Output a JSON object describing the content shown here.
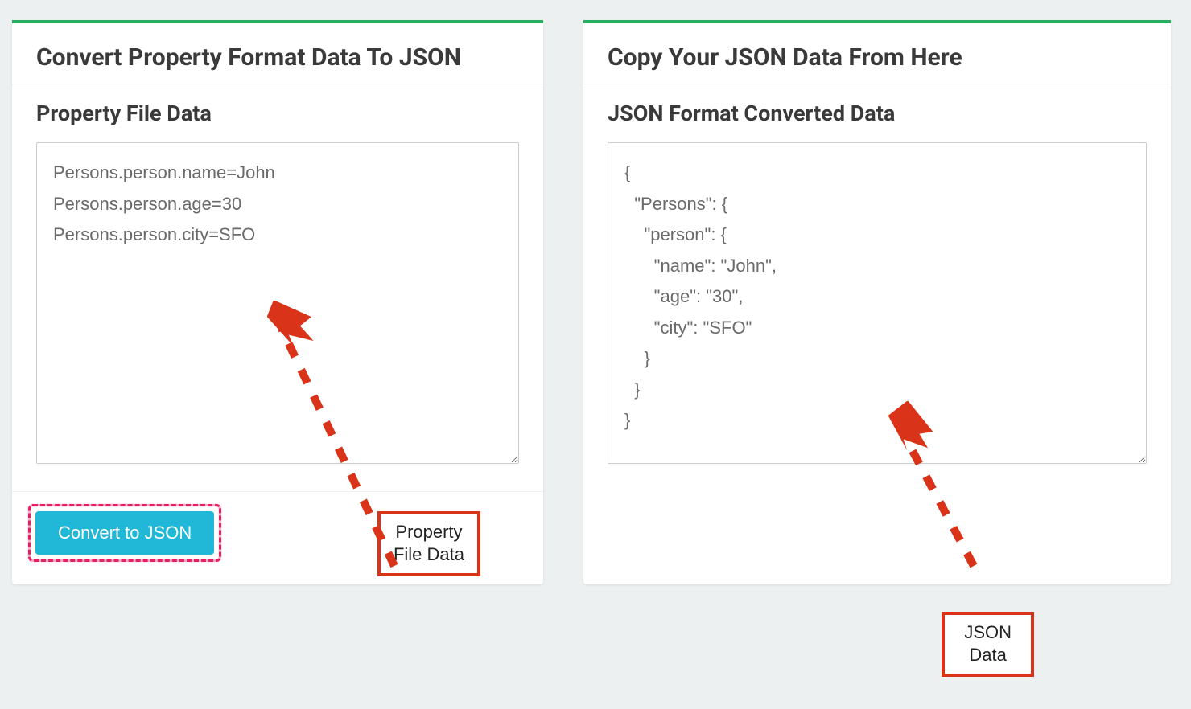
{
  "left": {
    "title": "Convert Property Format Data To JSON",
    "section_title": "Property File Data",
    "textarea_value": "Persons.person.name=John\nPersons.person.age=30\nPersons.person.city=SFO",
    "button_label": "Convert to JSON",
    "annotation_label": "Property\nFile Data"
  },
  "right": {
    "title": "Copy Your JSON Data From Here",
    "section_title": "JSON Format Converted Data",
    "textarea_value": "{\n  \"Persons\": {\n    \"person\": {\n      \"name\": \"John\",\n      \"age\": \"30\",\n      \"city\": \"SFO\"\n    }\n  }\n}",
    "annotation_label": "JSON\nData"
  },
  "colors": {
    "accent_green": "#27ae60",
    "button_blue": "#20b8d6",
    "highlight_pink": "#e91e63",
    "annotation_red": "#d9341a"
  }
}
